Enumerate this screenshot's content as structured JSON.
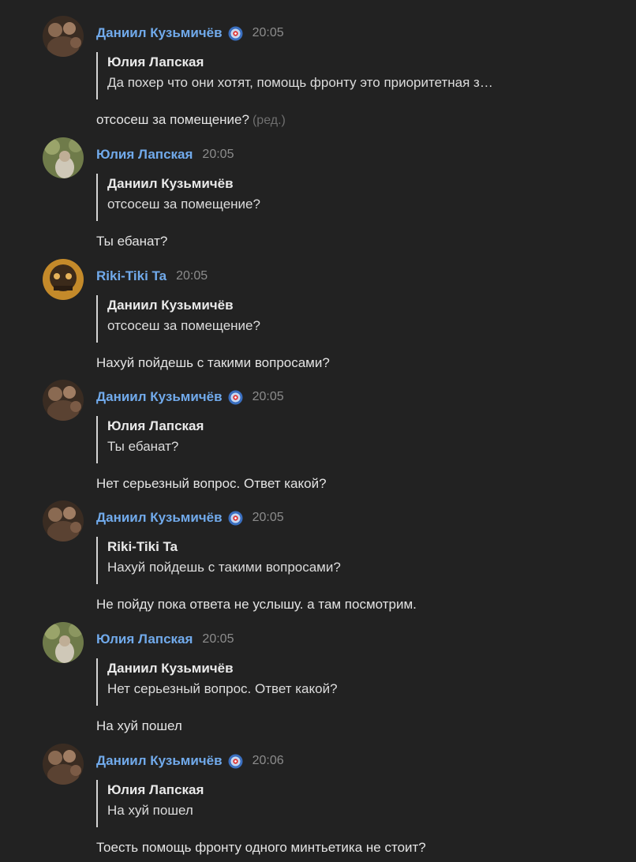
{
  "messages": [
    {
      "avatar": "avatar-daniil",
      "author": "Даниил Кузьмичёв",
      "badge": "shield-badge-icon",
      "time": "20:05",
      "quote": {
        "author": "Юлия Лапская",
        "text": "Да похер что они хотят, помощь фронту это приоритетная з…"
      },
      "text": "отсосеш за помещение?",
      "edited": "(ред.)"
    },
    {
      "avatar": "avatar-yulia",
      "author": "Юлия Лапская",
      "time": "20:05",
      "quote": {
        "author": "Даниил Кузьмичёв",
        "text": "отсосеш за помещение?"
      },
      "text": "Ты ебанат?"
    },
    {
      "avatar": "avatar-riki",
      "author": "Riki-Tiki Ta",
      "time": "20:05",
      "quote": {
        "author": "Даниил Кузьмичёв",
        "text": "отсосеш за помещение?"
      },
      "text": "Нахуй пойдешь с такими вопросами?"
    },
    {
      "avatar": "avatar-daniil",
      "author": "Даниил Кузьмичёв",
      "badge": "shield-badge-icon",
      "time": "20:05",
      "quote": {
        "author": "Юлия Лапская",
        "text": "Ты ебанат?"
      },
      "text": "Нет серьезный вопрос. Ответ какой?"
    },
    {
      "avatar": "avatar-daniil",
      "author": "Даниил Кузьмичёв",
      "badge": "shield-badge-icon",
      "time": "20:05",
      "quote": {
        "author": "Riki-Tiki Ta",
        "text": "Нахуй пойдешь с такими вопросами?"
      },
      "text": "Не пойду пока ответа не услышу. а там посмотрим."
    },
    {
      "avatar": "avatar-yulia",
      "author": "Юлия Лапская",
      "time": "20:05",
      "quote": {
        "author": "Даниил Кузьмичёв",
        "text": "Нет серьезный вопрос. Ответ какой?"
      },
      "text": "На хуй пошел"
    },
    {
      "avatar": "avatar-daniil",
      "author": "Даниил Кузьмичёв",
      "badge": "shield-badge-icon",
      "time": "20:06",
      "quote": {
        "author": "Юлия Лапская",
        "text": "На хуй пошел"
      },
      "text": "Тоесть помощь фронту одного минтьетика не стоит?"
    }
  ],
  "colors": {
    "background": "#222222",
    "author": "#71aaeb",
    "time": "#8c8c8c",
    "quote_bar": "#d4d4d4"
  }
}
